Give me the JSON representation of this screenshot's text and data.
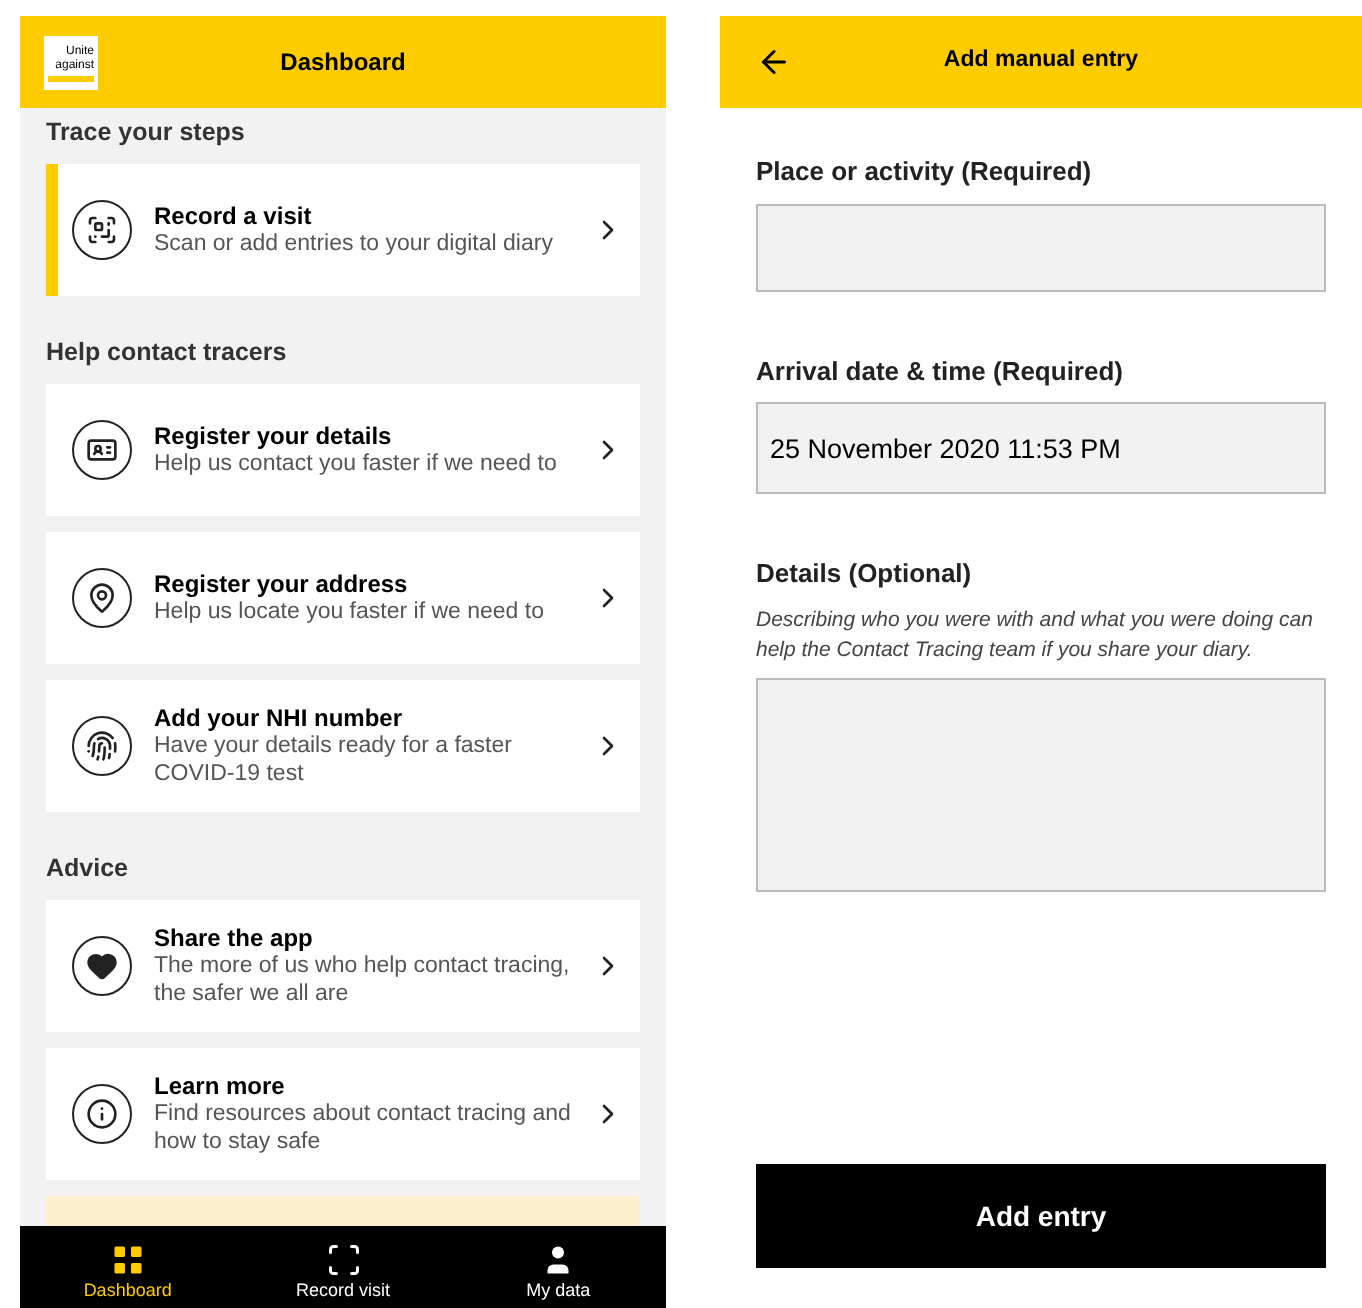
{
  "dashboard": {
    "logo": {
      "line_1": "Unite",
      "line_2": "against"
    },
    "title": "Dashboard",
    "sections": [
      {
        "heading": "Trace your steps",
        "cards": [
          {
            "title": "Record a visit",
            "subtitle": "Scan or add entries to your digital diary",
            "highlighted": true
          }
        ]
      },
      {
        "heading": "Help contact tracers",
        "cards": [
          {
            "title": "Register your details",
            "subtitle": "Help us contact you faster if we need to",
            "highlighted": false
          },
          {
            "title": "Register your address",
            "subtitle": "Help us locate you faster if we need to",
            "highlighted": false
          },
          {
            "title": "Add your NHI number",
            "subtitle": "Have your details ready for a faster COVID-19 test",
            "highlighted": false
          }
        ]
      },
      {
        "heading": "Advice",
        "cards": [
          {
            "title": "Share the app",
            "subtitle": "The more of us who help contact tracing, the safer we all are",
            "highlighted": false
          },
          {
            "title": "Learn more",
            "subtitle": "Find resources about contact tracing and how to stay safe",
            "highlighted": false
          }
        ]
      }
    ],
    "bottom_nav": [
      {
        "label": "Dashboard",
        "selected": true
      },
      {
        "label": "Record visit",
        "selected": false
      },
      {
        "label": "My data",
        "selected": false
      }
    ]
  },
  "manual_entry": {
    "title": "Add manual entry",
    "fields": [
      {
        "label": "Place or activity (Required)",
        "kind": "input"
      },
      {
        "label": "Arrival date & time (Required)",
        "kind": "input",
        "value": "25 November 2020 11:53 PM"
      },
      {
        "label": "Details (Optional)",
        "kind": "textarea",
        "help": "Describing who you were with and what you were doing can help the Contact Tracing team if you share your diary."
      }
    ],
    "submit": "Add entry"
  }
}
